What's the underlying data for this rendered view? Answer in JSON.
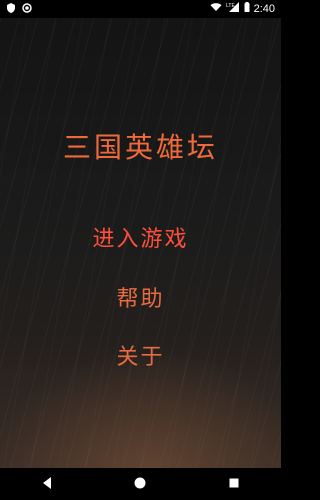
{
  "status_bar": {
    "time": "2:40",
    "network": "LTE"
  },
  "app": {
    "title": "三国英雄坛",
    "menu": {
      "start_label": "进入游戏",
      "help_label": "帮助",
      "about_label": "关于"
    }
  },
  "colors": {
    "title": "#ee6a3a",
    "start": "#ff4e3a",
    "menu": "#e76b3f"
  },
  "icons": {
    "status_left": [
      "android-shield-icon",
      "record-icon"
    ],
    "status_right": [
      "wifi-icon",
      "lte-signal-icon",
      "battery-icon"
    ],
    "nav": [
      "back-icon",
      "home-icon",
      "recents-icon"
    ]
  }
}
